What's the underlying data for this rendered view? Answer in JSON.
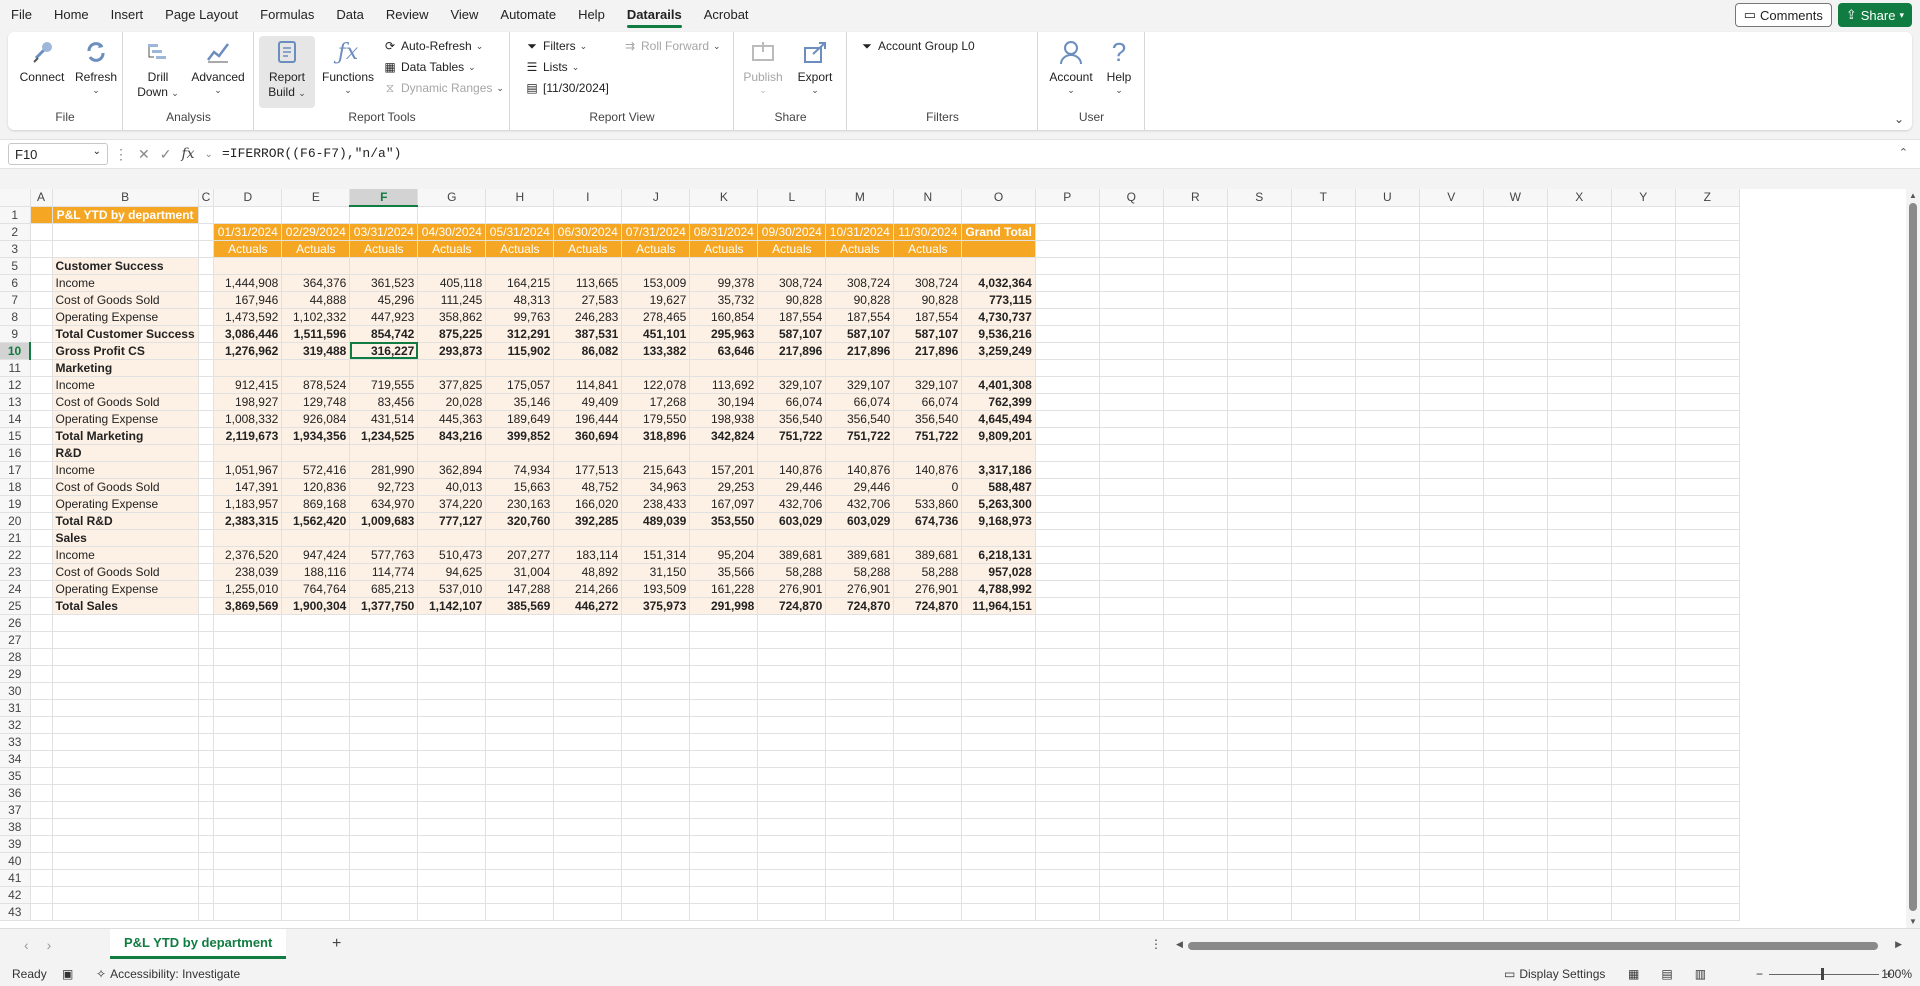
{
  "menu": {
    "tabs": [
      "File",
      "Home",
      "Insert",
      "Page Layout",
      "Formulas",
      "Data",
      "Review",
      "View",
      "Automate",
      "Help",
      "Datarails",
      "Acrobat"
    ],
    "active_tab": "Datarails",
    "comments_label": "Comments",
    "share_label": "Share"
  },
  "ribbon": {
    "file_group": {
      "label": "File",
      "connect": "Connect",
      "refresh": "Refresh"
    },
    "analysis_group": {
      "label": "Analysis",
      "drill_down_1": "Drill",
      "drill_down_2": "Down",
      "advanced": "Advanced"
    },
    "report_tools": {
      "label": "Report Tools",
      "report_builder_1": "Report",
      "report_builder_2": "Build",
      "functions": "Functions",
      "auto_refresh": "Auto-Refresh",
      "data_tables": "Data Tables",
      "dynamic_ranges": "Dynamic Ranges"
    },
    "report_view": {
      "label": "Report View",
      "filters": "Filters",
      "roll_forward": "Roll Forward",
      "lists": "Lists",
      "date": "[11/30/2024]"
    },
    "share_group": {
      "label": "Share",
      "publish": "Publish",
      "export": "Export"
    },
    "filters_group": {
      "label": "Filters",
      "account_group": "Account Group L0"
    },
    "user_group": {
      "label": "User",
      "account": "Account",
      "help": "Help"
    }
  },
  "formula_bar": {
    "name_box": "F10",
    "formula": "=IFERROR((F6-F7),\"n/a\")"
  },
  "sheet": {
    "columns": [
      "A",
      "B",
      "C",
      "D",
      "E",
      "F",
      "G",
      "H",
      "I",
      "J",
      "K",
      "L",
      "M",
      "N",
      "O",
      "P",
      "Q",
      "R",
      "S",
      "T",
      "U",
      "V",
      "W",
      "X",
      "Y",
      "Z"
    ],
    "title": "P&L YTD by department",
    "dates": [
      "01/31/2024",
      "02/29/2024",
      "03/31/2024",
      "04/30/2024",
      "05/31/2024",
      "06/30/2024",
      "07/31/2024",
      "08/31/2024",
      "09/30/2024",
      "10/31/2024",
      "11/30/2024"
    ],
    "actuals": "Actuals",
    "grand_total": "Grand Total",
    "rows": [
      {
        "n": "5",
        "label": "Customer Success",
        "type": "section"
      },
      {
        "n": "6",
        "label": "Income",
        "type": "item",
        "v": [
          "1,444,908",
          "364,376",
          "361,523",
          "405,118",
          "164,215",
          "113,665",
          "153,009",
          "99,378",
          "308,724",
          "308,724",
          "308,724"
        ],
        "t": "4,032,364"
      },
      {
        "n": "7",
        "label": "Cost of Goods Sold",
        "type": "item",
        "v": [
          "167,946",
          "44,888",
          "45,296",
          "111,245",
          "48,313",
          "27,583",
          "19,627",
          "35,732",
          "90,828",
          "90,828",
          "90,828"
        ],
        "t": "773,115"
      },
      {
        "n": "8",
        "label": "Operating Expense",
        "type": "item",
        "v": [
          "1,473,592",
          "1,102,332",
          "447,923",
          "358,862",
          "99,763",
          "246,283",
          "278,465",
          "160,854",
          "187,554",
          "187,554",
          "187,554"
        ],
        "t": "4,730,737"
      },
      {
        "n": "9",
        "label": "Total Customer Success",
        "type": "total",
        "v": [
          "3,086,446",
          "1,511,596",
          "854,742",
          "875,225",
          "312,291",
          "387,531",
          "451,101",
          "295,963",
          "587,107",
          "587,107",
          "587,107"
        ],
        "t": "9,536,216"
      },
      {
        "n": "10",
        "label": "Gross Profit CS",
        "type": "total",
        "v": [
          "1,276,962",
          "319,488",
          "316,227",
          "293,873",
          "115,902",
          "86,082",
          "133,382",
          "63,646",
          "217,896",
          "217,896",
          "217,896"
        ],
        "t": "3,259,249"
      },
      {
        "n": "11",
        "label": "Marketing",
        "type": "section"
      },
      {
        "n": "12",
        "label": "Income",
        "type": "item",
        "v": [
          "912,415",
          "878,524",
          "719,555",
          "377,825",
          "175,057",
          "114,841",
          "122,078",
          "113,692",
          "329,107",
          "329,107",
          "329,107"
        ],
        "t": "4,401,308"
      },
      {
        "n": "13",
        "label": "Cost of Goods Sold",
        "type": "item",
        "v": [
          "198,927",
          "129,748",
          "83,456",
          "20,028",
          "35,146",
          "49,409",
          "17,268",
          "30,194",
          "66,074",
          "66,074",
          "66,074"
        ],
        "t": "762,399"
      },
      {
        "n": "14",
        "label": "Operating Expense",
        "type": "item",
        "v": [
          "1,008,332",
          "926,084",
          "431,514",
          "445,363",
          "189,649",
          "196,444",
          "179,550",
          "198,938",
          "356,540",
          "356,540",
          "356,540"
        ],
        "t": "4,645,494"
      },
      {
        "n": "15",
        "label": "Total Marketing",
        "type": "total",
        "v": [
          "2,119,673",
          "1,934,356",
          "1,234,525",
          "843,216",
          "399,852",
          "360,694",
          "318,896",
          "342,824",
          "751,722",
          "751,722",
          "751,722"
        ],
        "t": "9,809,201"
      },
      {
        "n": "16",
        "label": "R&D",
        "type": "section"
      },
      {
        "n": "17",
        "label": "Income",
        "type": "item",
        "v": [
          "1,051,967",
          "572,416",
          "281,990",
          "362,894",
          "74,934",
          "177,513",
          "215,643",
          "157,201",
          "140,876",
          "140,876",
          "140,876"
        ],
        "t": "3,317,186"
      },
      {
        "n": "18",
        "label": "Cost of Goods Sold",
        "type": "item",
        "v": [
          "147,391",
          "120,836",
          "92,723",
          "40,013",
          "15,663",
          "48,752",
          "34,963",
          "29,253",
          "29,446",
          "29,446",
          "0"
        ],
        "t": "588,487"
      },
      {
        "n": "19",
        "label": "Operating Expense",
        "type": "item",
        "v": [
          "1,183,957",
          "869,168",
          "634,970",
          "374,220",
          "230,163",
          "166,020",
          "238,433",
          "167,097",
          "432,706",
          "432,706",
          "533,860"
        ],
        "t": "5,263,300"
      },
      {
        "n": "20",
        "label": "Total R&D",
        "type": "total",
        "v": [
          "2,383,315",
          "1,562,420",
          "1,009,683",
          "777,127",
          "320,760",
          "392,285",
          "489,039",
          "353,550",
          "603,029",
          "603,029",
          "674,736"
        ],
        "t": "9,168,973"
      },
      {
        "n": "21",
        "label": "Sales",
        "type": "section"
      },
      {
        "n": "22",
        "label": "Income",
        "type": "item",
        "v": [
          "2,376,520",
          "947,424",
          "577,763",
          "510,473",
          "207,277",
          "183,114",
          "151,314",
          "95,204",
          "389,681",
          "389,681",
          "389,681"
        ],
        "t": "6,218,131"
      },
      {
        "n": "23",
        "label": "Cost of Goods Sold",
        "type": "item",
        "v": [
          "238,039",
          "188,116",
          "114,774",
          "94,625",
          "31,004",
          "48,892",
          "31,150",
          "35,566",
          "58,288",
          "58,288",
          "58,288"
        ],
        "t": "957,028"
      },
      {
        "n": "24",
        "label": "Operating Expense",
        "type": "item",
        "v": [
          "1,255,010",
          "764,764",
          "685,213",
          "537,010",
          "147,288",
          "214,266",
          "193,509",
          "161,228",
          "276,901",
          "276,901",
          "276,901"
        ],
        "t": "4,788,992"
      },
      {
        "n": "25",
        "label": "Total Sales",
        "type": "total",
        "v": [
          "3,869,569",
          "1,900,304",
          "1,377,750",
          "1,142,107",
          "385,569",
          "446,272",
          "375,973",
          "291,998",
          "724,870",
          "724,870",
          "724,870"
        ],
        "t": "11,964,151"
      }
    ],
    "empty_rows": [
      "26",
      "27",
      "28",
      "29",
      "30",
      "31",
      "32",
      "33",
      "34",
      "35",
      "36",
      "37",
      "38",
      "39",
      "40",
      "41",
      "42",
      "43"
    ]
  },
  "sheet_tabs": {
    "active": "P&L YTD by department",
    "add": "+"
  },
  "status_bar": {
    "ready": "Ready",
    "accessibility": "Accessibility: Investigate",
    "display_settings": "Display Settings",
    "zoom": "100%"
  },
  "colors": {
    "accent": "#107c41",
    "header_orange": "#f5a623",
    "row_peach": "#fdf0e4"
  }
}
